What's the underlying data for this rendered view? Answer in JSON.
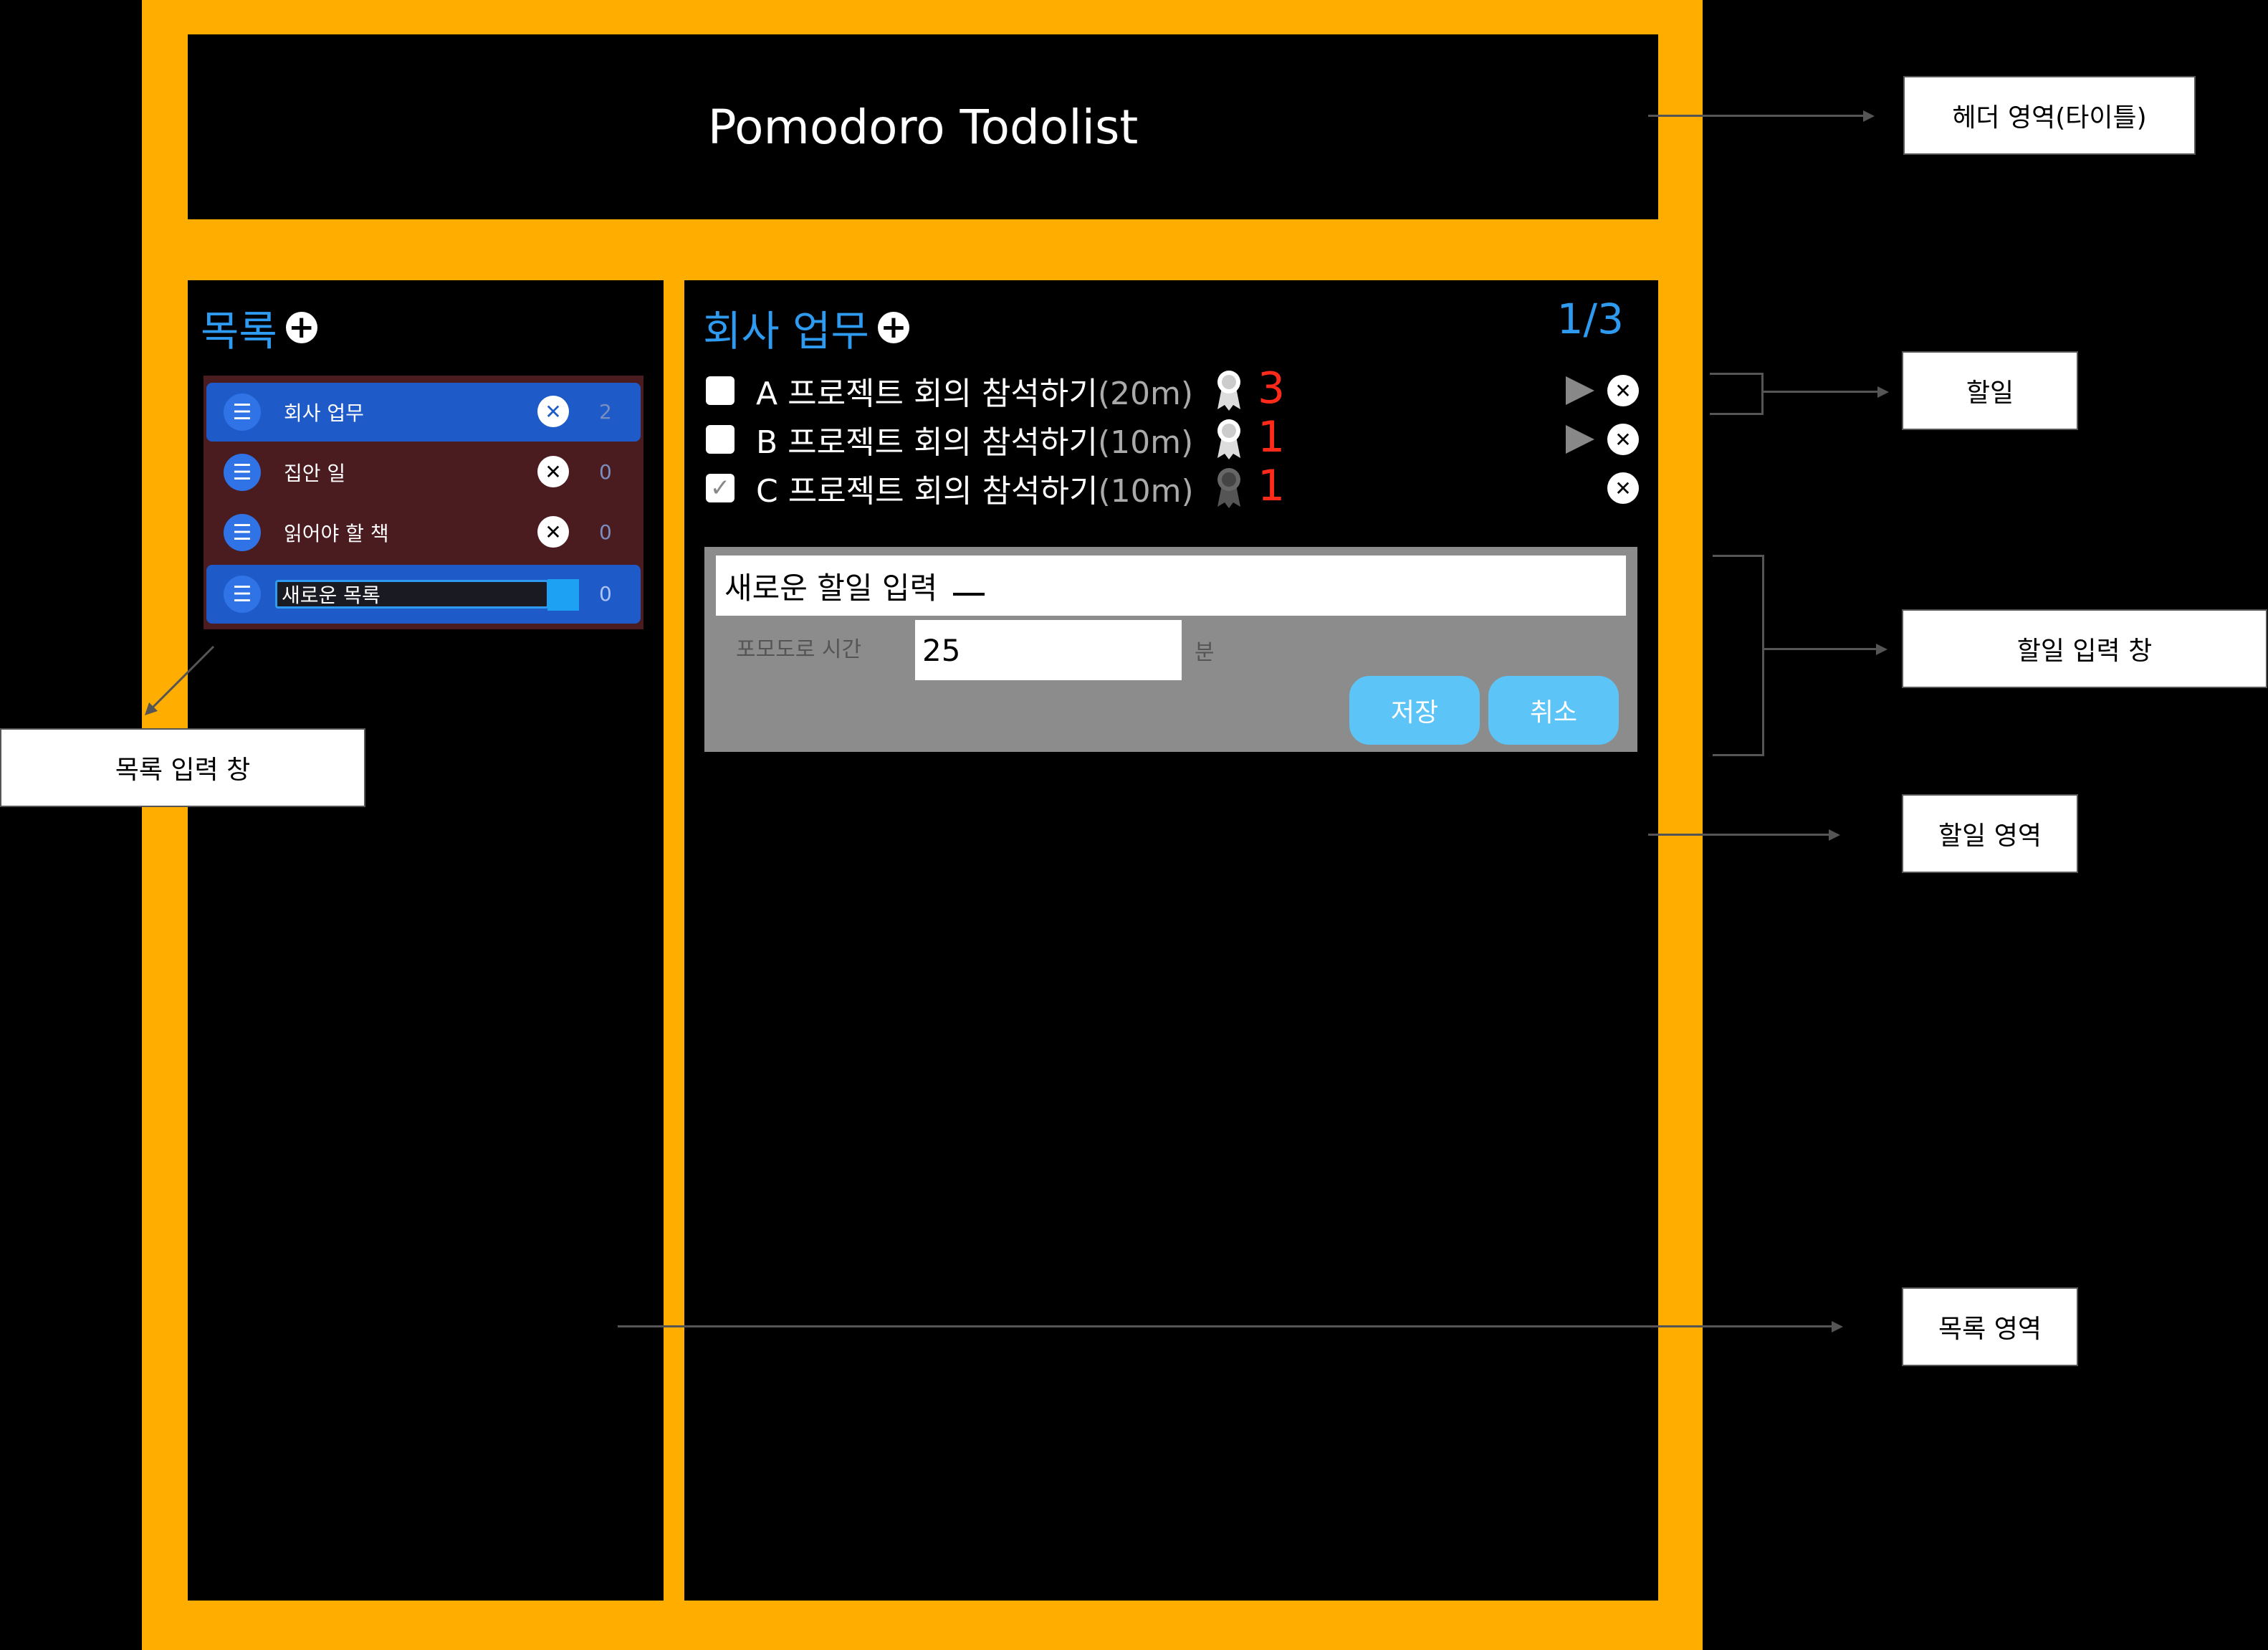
{
  "header": {
    "title": "Pomodoro Todolist"
  },
  "list_panel": {
    "title": "목록",
    "items": [
      {
        "label": "회사 업무",
        "count": "2"
      },
      {
        "label": "집안 일",
        "count": "0"
      },
      {
        "label": "읽어야 할 책",
        "count": "0"
      }
    ],
    "new_item": {
      "value": "새로운 목록",
      "count": "0"
    }
  },
  "todo_panel": {
    "title": "회사 업무",
    "page_indicator": "1/3",
    "todos": [
      {
        "prefix": "A 프로젝트 회의 참석하기",
        "duration": "(20m)",
        "pomodoros": "3",
        "checked": false
      },
      {
        "prefix": "B 프로젝트 회의 참석하기",
        "duration": "(10m)",
        "pomodoros": "1",
        "checked": false
      },
      {
        "prefix": "C 프로젝트 회의 참석하기",
        "duration": "(10m)",
        "pomodoros": "1",
        "checked": true
      }
    ],
    "form": {
      "todo_input_value": "새로운 할일 입력",
      "pomodoro_label": "포모도로 시간",
      "pomodoro_value": "25",
      "pomodoro_unit": "분",
      "save_label": "저장",
      "cancel_label": "취소"
    }
  },
  "annotations": {
    "header_area": "헤더 영역(타이틀)",
    "todo": "할일",
    "todo_input": "할일 입력 창",
    "todo_area": "할일 영역",
    "list_area": "목록 영역",
    "list_input": "목록 입력 창"
  },
  "colors": {
    "frame": "#FFAE00",
    "accent": "#2E9AF0",
    "active_item": "#1E5BC8",
    "pomodoro_count": "#FF2A1A"
  }
}
